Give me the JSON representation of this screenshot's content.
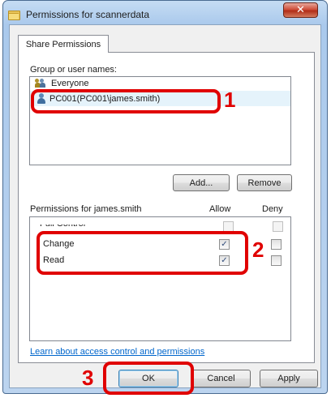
{
  "window": {
    "title": "Permissions for scannerdata",
    "close_glyph": "✕"
  },
  "tab": {
    "label": "Share Permissions"
  },
  "groups": {
    "label": "Group or user names:",
    "items": [
      {
        "name": "Everyone",
        "icon": "group-icon"
      },
      {
        "name": "PC001(PC001\\james.smith)",
        "icon": "user-icon",
        "selected": true
      }
    ],
    "add_label": "Add...",
    "remove_label": "Remove"
  },
  "permissions": {
    "label": "Permissions for james.smith",
    "allow_header": "Allow",
    "deny_header": "Deny",
    "rows": [
      {
        "name": "Full Control",
        "allow": false,
        "deny": false
      },
      {
        "name": "Change",
        "allow": true,
        "deny": false
      },
      {
        "name": "Read",
        "allow": true,
        "deny": false
      }
    ]
  },
  "link": {
    "text": "Learn about access control and permissions"
  },
  "buttons": {
    "ok": "OK",
    "cancel": "Cancel",
    "apply": "Apply"
  },
  "annotations": {
    "one": "1",
    "two": "2",
    "three": "3"
  },
  "colors": {
    "callout": "#e00000",
    "link": "#0066cc"
  }
}
